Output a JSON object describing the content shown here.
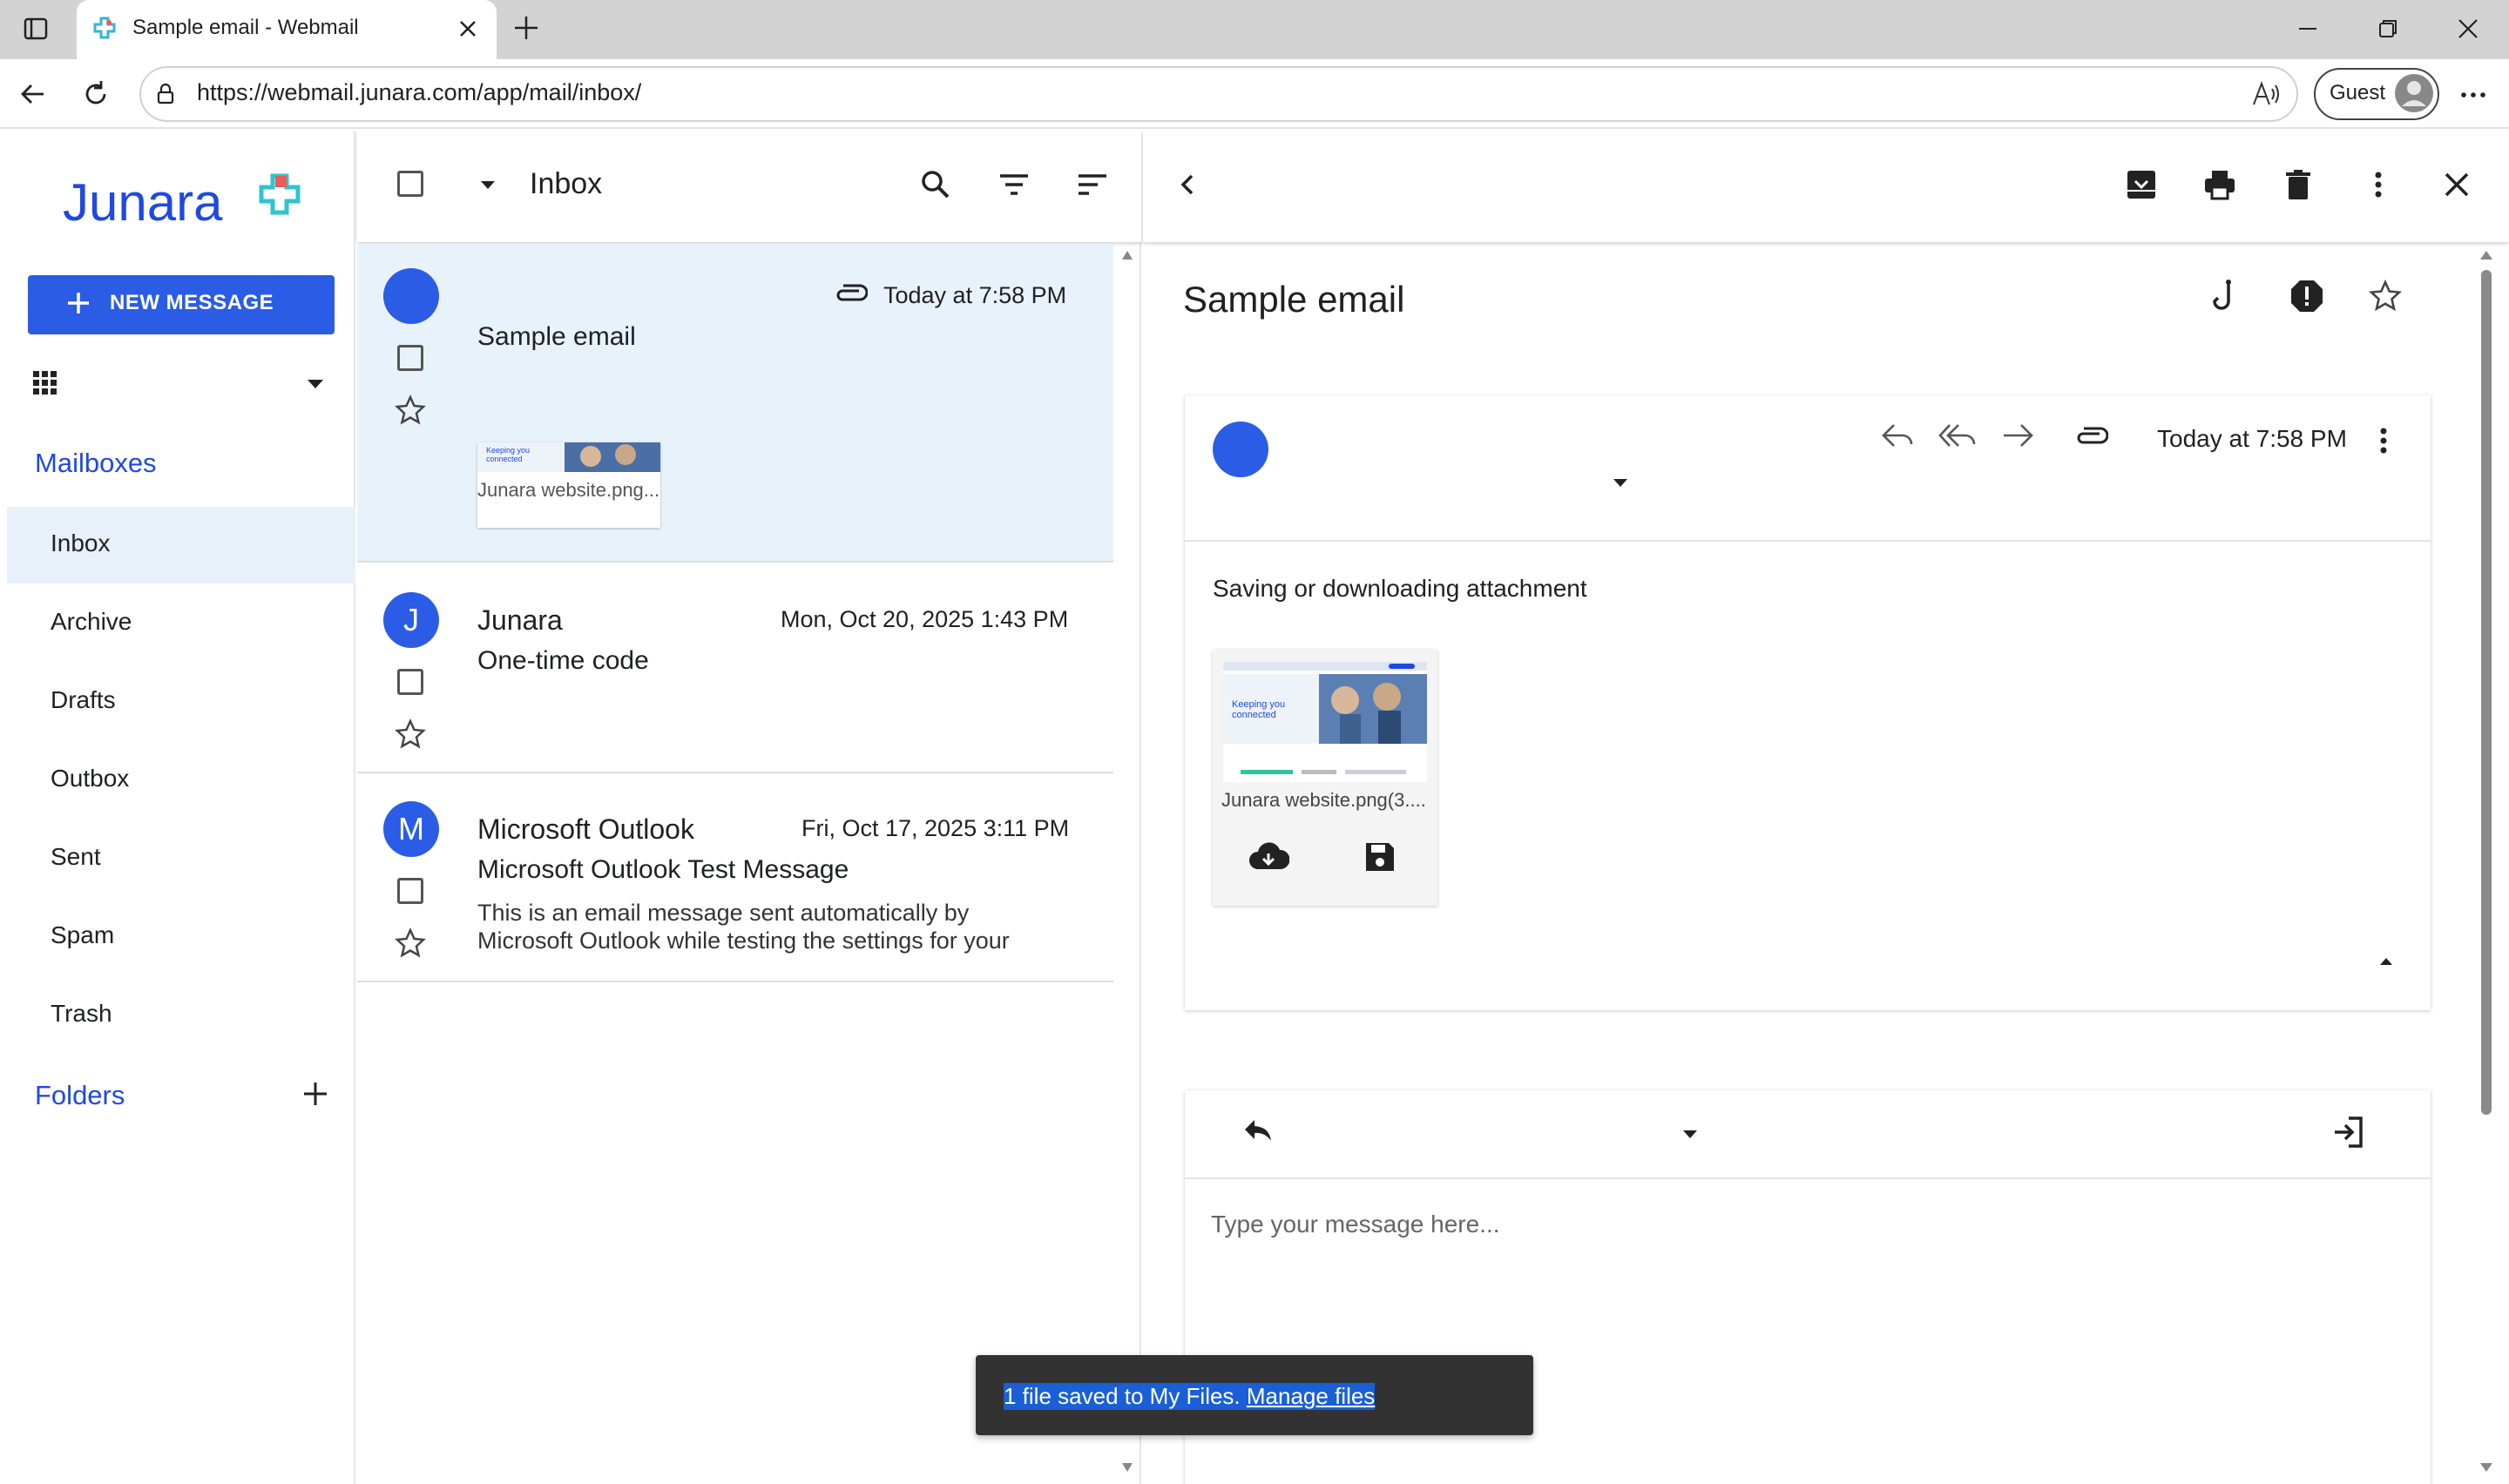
{
  "browser": {
    "tab_title": "Sample email - Webmail",
    "url": "https://webmail.junara.com/app/mail/inbox/",
    "guest_label": "Guest"
  },
  "app": {
    "logo_text": "Junara",
    "new_message_label": "NEW MESSAGE",
    "mailboxes_title": "Mailboxes",
    "folders_title": "Folders",
    "nav": [
      {
        "label": "Inbox",
        "active": true
      },
      {
        "label": "Archive"
      },
      {
        "label": "Drafts"
      },
      {
        "label": "Outbox"
      },
      {
        "label": "Sent"
      },
      {
        "label": "Spam"
      },
      {
        "label": "Trash"
      }
    ]
  },
  "list": {
    "title": "Inbox",
    "items": [
      {
        "avatar": "",
        "sender": "",
        "date": "Today at 7:58 PM",
        "subject": "Sample email",
        "attachment": "Junara website.png..."
      },
      {
        "avatar": "J",
        "sender": "Junara",
        "date": "Mon, Oct 20, 2025 1:43 PM",
        "subject": "One-time code"
      },
      {
        "avatar": "M",
        "sender": "Microsoft Outlook",
        "date": "Fri, Oct 17, 2025 3:11 PM",
        "subject": "Microsoft Outlook Test Message",
        "preview_line1": "This is an email message sent automatically by",
        "preview_line2": "Microsoft Outlook while testing the settings for your"
      }
    ]
  },
  "reader": {
    "title": "Sample email",
    "date": "Today at 7:58 PM",
    "body": "Saving or downloading attachment",
    "attachment_name": "Junara website.png(3....",
    "reply_placeholder": "Type your message here..."
  },
  "snackbar": {
    "text": "1 file saved to My Files.",
    "link": "Manage files"
  },
  "colors": {
    "accent": "#2b5ce6",
    "selected_row": "#e8f2fb",
    "nav_active": "#e8f0fa"
  }
}
